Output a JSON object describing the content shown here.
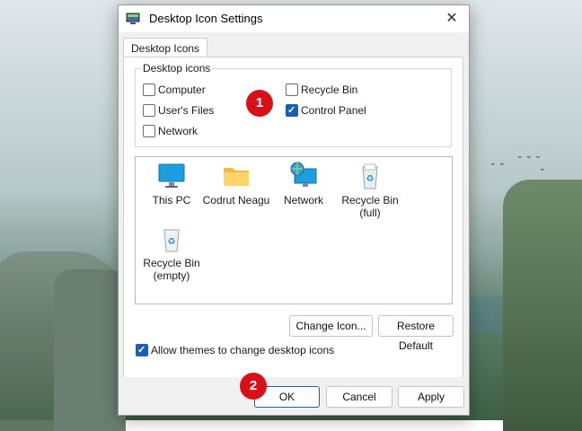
{
  "dialog": {
    "title": "Desktop Icon Settings",
    "close_glyph": "✕",
    "tab_label": "Desktop Icons"
  },
  "desktop_icons_group": {
    "label": "Desktop icons",
    "options": [
      {
        "label": "Computer",
        "checked": false
      },
      {
        "label": "User's Files",
        "checked": false
      },
      {
        "label": "Network",
        "checked": false
      },
      {
        "label": "Recycle Bin",
        "checked": false
      },
      {
        "label": "Control Panel",
        "checked": true
      }
    ]
  },
  "icon_list": [
    {
      "label": "This PC",
      "icon": "monitor-icon"
    },
    {
      "label": "Codrut Neagu",
      "icon": "folder-icon"
    },
    {
      "label": "Network",
      "icon": "network-icon"
    },
    {
      "label": "Recycle Bin (full)",
      "line1": "Recycle Bin",
      "line2": "(full)",
      "icon": "recycle-bin-full-icon"
    },
    {
      "label": "Recycle Bin (empty)",
      "line1": "Recycle Bin",
      "line2": "(empty)",
      "icon": "recycle-bin-empty-icon"
    }
  ],
  "buttons": {
    "change_icon": "Change Icon...",
    "restore_default": "Restore Default",
    "ok": "OK",
    "cancel": "Cancel",
    "apply": "Apply"
  },
  "allow_themes": {
    "label": "Allow themes to change desktop icons",
    "checked": true
  },
  "annotations": [
    {
      "number": "1"
    },
    {
      "number": "2"
    }
  ],
  "colors": {
    "badge": "#d9101a",
    "checkbox_accent": "#1a5fb4"
  }
}
